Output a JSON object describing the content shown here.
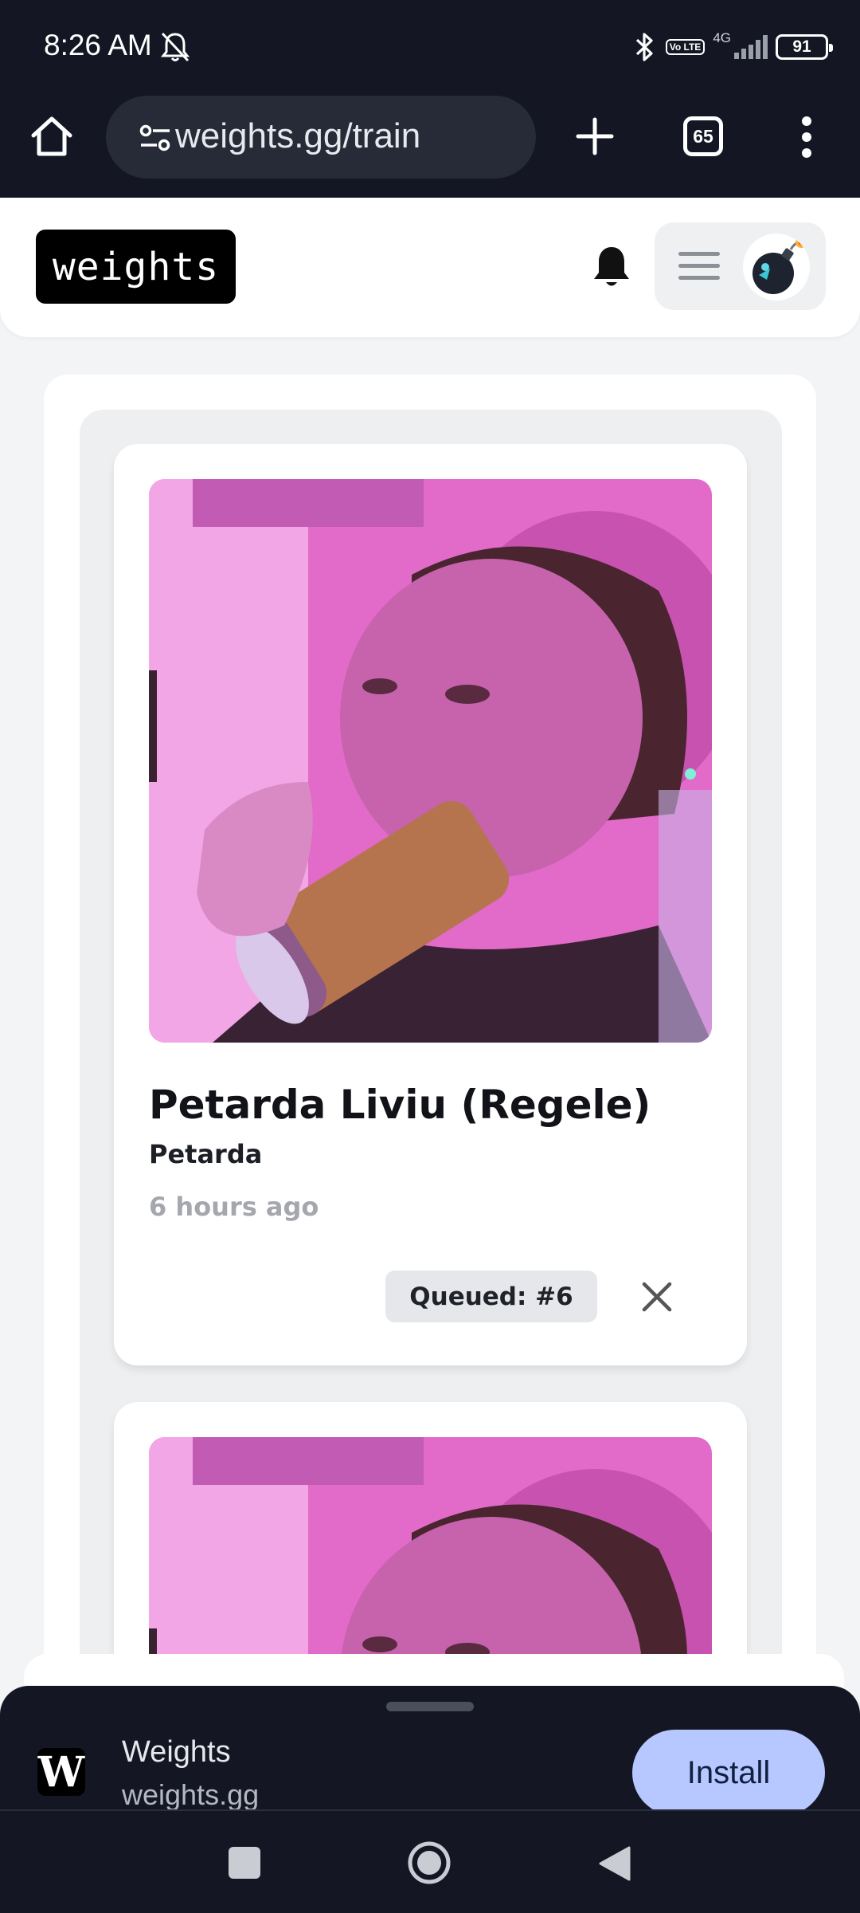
{
  "status_bar": {
    "time": "8:26 AM",
    "network": "4G",
    "volte": "Vo LTE",
    "battery": "91"
  },
  "browser": {
    "url": "weights.gg/train",
    "tab_count": "65"
  },
  "site_header": {
    "logo_text": "weights"
  },
  "queue_items": [
    {
      "title": "Petarda Liviu (Regele)",
      "username": "Petarda",
      "time_ago": "6 hours ago",
      "status_badge": "Queued: #6"
    }
  ],
  "install_banner": {
    "app_icon_letter": "W",
    "app_name": "Weights",
    "app_url": "weights.gg",
    "install_label": "Install"
  },
  "colors": {
    "system_bar": "#141723",
    "page_background": "#f3f4f6",
    "badge_background": "#e6e7ea",
    "install_button": "#b6c8ff",
    "photo_tint": "#e26ac8"
  },
  "icons": {
    "status": [
      "bell-slash-icon",
      "bluetooth-icon",
      "signal-icon",
      "battery-icon"
    ],
    "toolbar": [
      "home-icon",
      "site-settings-icon",
      "new-tab-plus-icon",
      "tab-switcher-icon",
      "more-vert-icon"
    ],
    "header": [
      "notification-bell-icon",
      "hamburger-menu-icon",
      "avatar"
    ],
    "system_nav": [
      "recents-square-icon",
      "home-circle-icon",
      "back-triangle-icon"
    ]
  }
}
